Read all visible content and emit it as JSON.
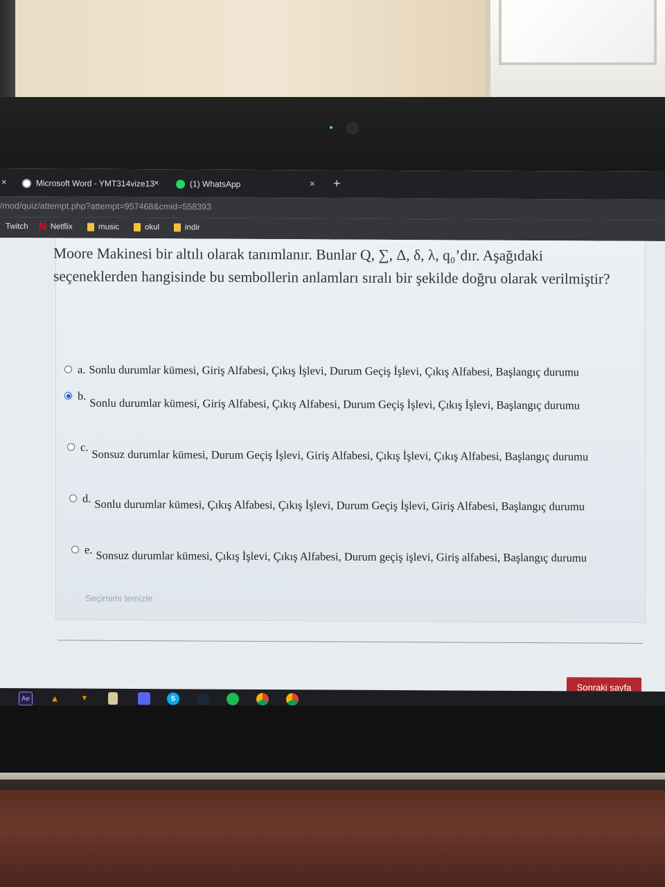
{
  "browser": {
    "tabs": [
      {
        "label": "Microsoft Word - YMT314vize13",
        "icon": "globe-icon"
      },
      {
        "label": "(1) WhatsApp",
        "icon": "whatsapp-icon"
      }
    ],
    "left_close": "×",
    "tab_close": "×",
    "new_tab": "+",
    "url": "/mod/quiz/attempt.php?attempt=957468&cmid=558393",
    "bookmarks": [
      {
        "label": "Twitch",
        "icon": "none"
      },
      {
        "label": "Netflix",
        "icon": "netflix-icon"
      },
      {
        "label": "music",
        "icon": "folder-icon"
      },
      {
        "label": "okul",
        "icon": "folder-icon"
      },
      {
        "label": "indir",
        "icon": "folder-icon"
      }
    ]
  },
  "quiz": {
    "question": "Moore Makinesi bir altılı olarak tanımlanır. Bunlar Q, ∑, Δ, δ, λ, q₀’dır. Aşağıdaki seçeneklerden hangisinde bu sembollerin anlamları sıralı bir şekilde doğru olarak verilmiştir?",
    "answers": [
      {
        "letter": "a.",
        "text": "Sonlu durumlar kümesi, Giriş Alfabesi, Çıkış İşlevi, Durum Geçiş İşlevi, Çıkış Alfabesi, Başlangıç durumu",
        "selected": false
      },
      {
        "letter": "b.",
        "text": "Sonlu durumlar kümesi, Giriş Alfabesi, Çıkış Alfabesi, Durum Geçiş İşlevi, Çıkış İşlevi, Başlangıç durumu",
        "selected": true
      },
      {
        "letter": "c.",
        "text": "Sonsuz durumlar kümesi, Durum Geçiş İşlevi, Giriş Alfabesi, Çıkış İşlevi, Çıkış Alfabesi, Başlangıç durumu",
        "selected": false
      },
      {
        "letter": "d.",
        "text": "Sonlu durumlar kümesi, Çıkış Alfabesi, Çıkış İşlevi, Durum Geçiş İşlevi, Giriş Alfabesi, Başlangıç durumu",
        "selected": false
      },
      {
        "letter": "e.",
        "text": "Sonsuz durumlar kümesi, Çıkış İşlevi, Çıkış Alfabesi, Durum geçiş işlevi, Giriş alfabesi, Başlangıç durumu",
        "selected": false
      }
    ],
    "clear_choice": "Seçimimi temizle",
    "next_button": "Sonraki sayfa"
  },
  "taskbar": {
    "icons": [
      "ae-icon",
      "vlc-icon",
      "vlc-icon-2",
      "book-icon",
      "discord-icon",
      "skype-icon",
      "steam-icon",
      "spotify-icon",
      "chrome-icon",
      "chrome-icon-active"
    ],
    "ae_label": "Ae"
  },
  "colors": {
    "accent": "#1a5fcc",
    "next_button": "#b3272e",
    "link_muted": "#9aa7b4"
  }
}
